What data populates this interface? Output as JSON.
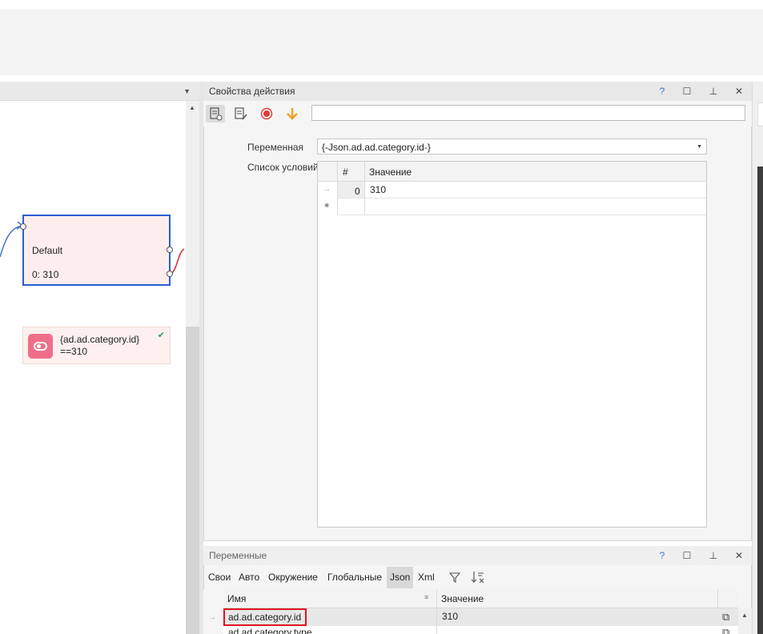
{
  "canvas": {
    "node": {
      "title": "Default",
      "case": "0: 310"
    },
    "condition": {
      "line1": "{ad.ad.category.id}",
      "line2": "==310"
    }
  },
  "properties": {
    "title": "Свойства действия",
    "help": "?",
    "maximize": "☐",
    "pin": "⊥",
    "close": "✕",
    "toolbar": {
      "search_value": "",
      "icons": [
        "settings-list-icon",
        "edit-list-icon",
        "record-icon",
        "down-arrow-icon"
      ]
    },
    "variable_label": "Переменная",
    "variable_value": "{-Json.ad.ad.category.id-}",
    "conditions_label": "Список условий",
    "grid": {
      "col_num": "#",
      "col_value": "Значение",
      "rows": [
        {
          "num": "0",
          "value": "310"
        }
      ],
      "row_indicator": "→",
      "new_row_indicator": "✷"
    }
  },
  "variables": {
    "title": "Переменные",
    "help": "?",
    "maximize": "☐",
    "pin": "⊥",
    "close": "✕",
    "tabs": [
      "Свои",
      "Авто",
      "Окружение",
      "Глобальные",
      "Json",
      "Xml"
    ],
    "selected_tab": "Json",
    "col_name": "Имя",
    "col_value": "Значение",
    "rows": [
      {
        "name": "ad.ad.category.id",
        "value": "310"
      },
      {
        "name": "ad.ad.category.type",
        "value": ""
      }
    ]
  }
}
